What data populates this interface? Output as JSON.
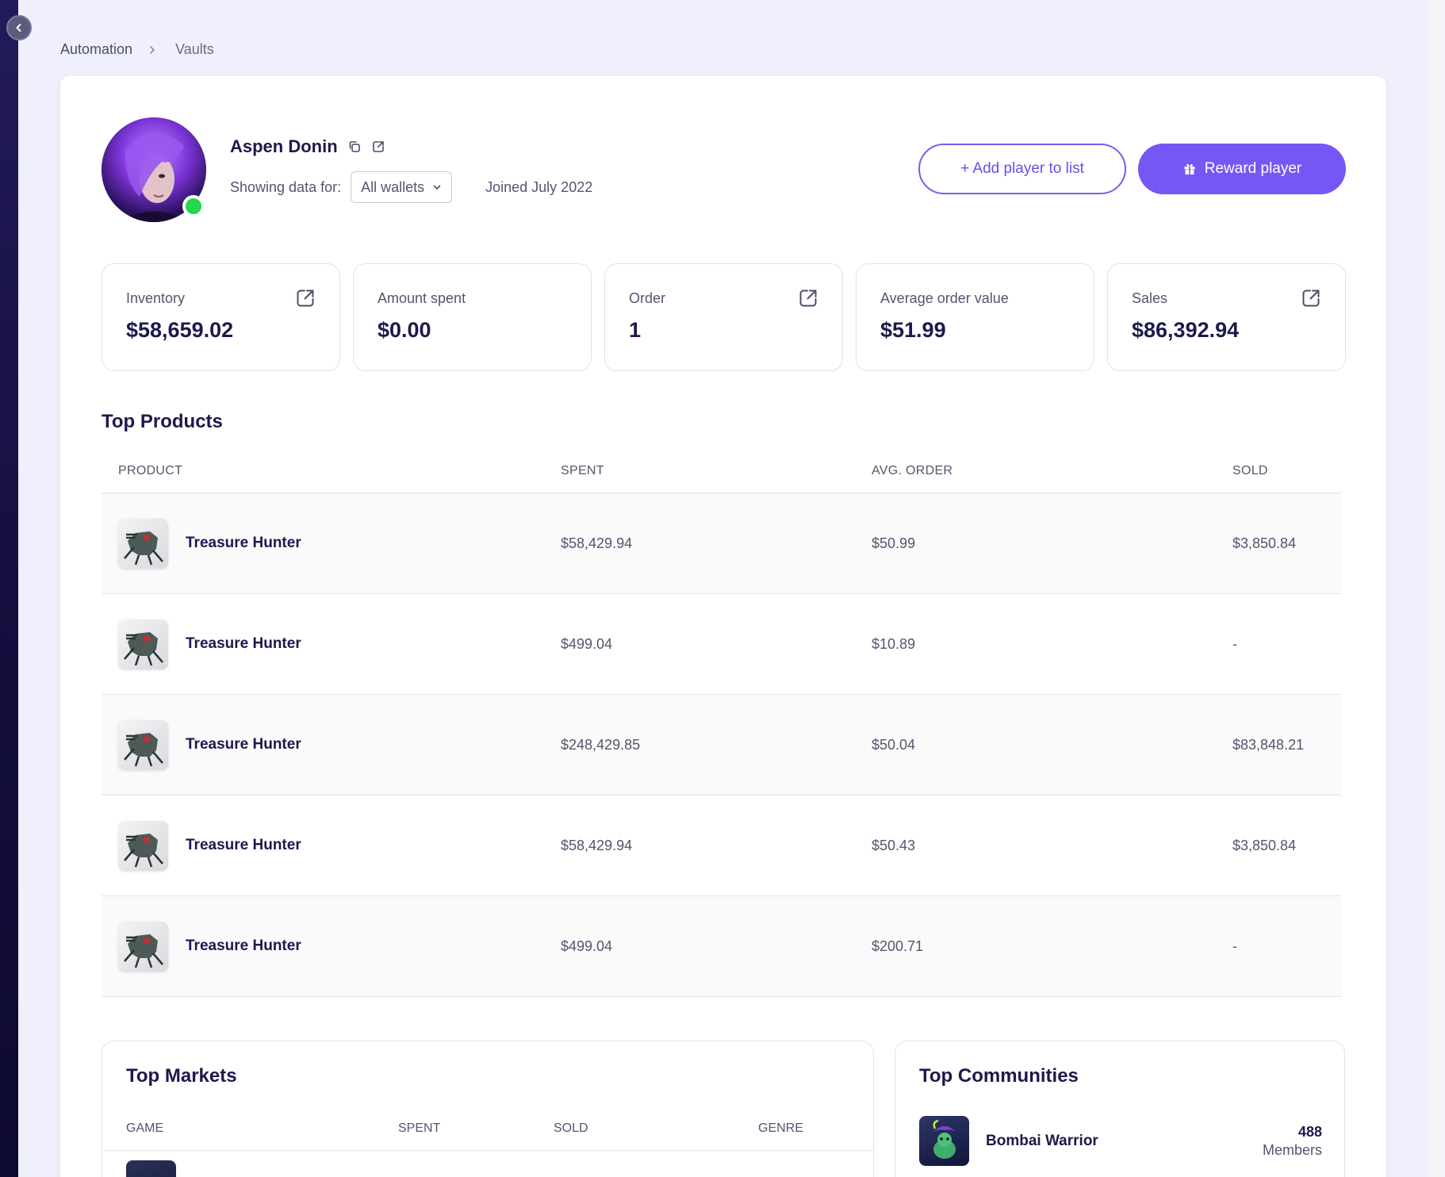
{
  "breadcrumb": {
    "items": [
      "Automation",
      "Vaults"
    ]
  },
  "player": {
    "name": "Aspen Donin",
    "showing_label": "Showing data for:",
    "wallet_selected": "All wallets",
    "joined": "Joined July 2022",
    "online": true
  },
  "actions": {
    "add_to_list": "+ Add player to list",
    "reward": "Reward player"
  },
  "stats": [
    {
      "label": "Inventory",
      "value": "$58,659.02",
      "has_link": true
    },
    {
      "label": "Amount spent",
      "value": "$0.00",
      "has_link": false
    },
    {
      "label": "Order",
      "value": "1",
      "has_link": true
    },
    {
      "label": "Average order value",
      "value": "$51.99",
      "has_link": false
    },
    {
      "label": "Sales",
      "value": "$86,392.94",
      "has_link": true
    }
  ],
  "top_products": {
    "title": "Top Products",
    "columns": [
      "PRODUCT",
      "SPENT",
      "AVG. ORDER",
      "SOLD"
    ],
    "rows": [
      {
        "product": "Treasure Hunter",
        "spent": "$58,429.94",
        "avg_order": "$50.99",
        "sold": "$3,850.84"
      },
      {
        "product": "Treasure Hunter",
        "spent": "$499.04",
        "avg_order": "$10.89",
        "sold": "-"
      },
      {
        "product": "Treasure Hunter",
        "spent": "$248,429.85",
        "avg_order": "$50.04",
        "sold": "$83,848.21"
      },
      {
        "product": "Treasure Hunter",
        "spent": "$58,429.94",
        "avg_order": "$50.43",
        "sold": "$3,850.84"
      },
      {
        "product": "Treasure Hunter",
        "spent": "$499.04",
        "avg_order": "$200.71",
        "sold": "-"
      }
    ]
  },
  "top_markets": {
    "title": "Top Markets",
    "columns": [
      "GAME",
      "SPENT",
      "SOLD",
      "GENRE"
    ]
  },
  "top_communities": {
    "title": "Top Communities",
    "items": [
      {
        "name": "Bombai Warrior",
        "members": "488",
        "members_label": "Members"
      }
    ]
  },
  "colors": {
    "accent": "#7657f5",
    "online": "#25d74a",
    "heading": "#1c1a4b",
    "background": "#eff0fb"
  }
}
